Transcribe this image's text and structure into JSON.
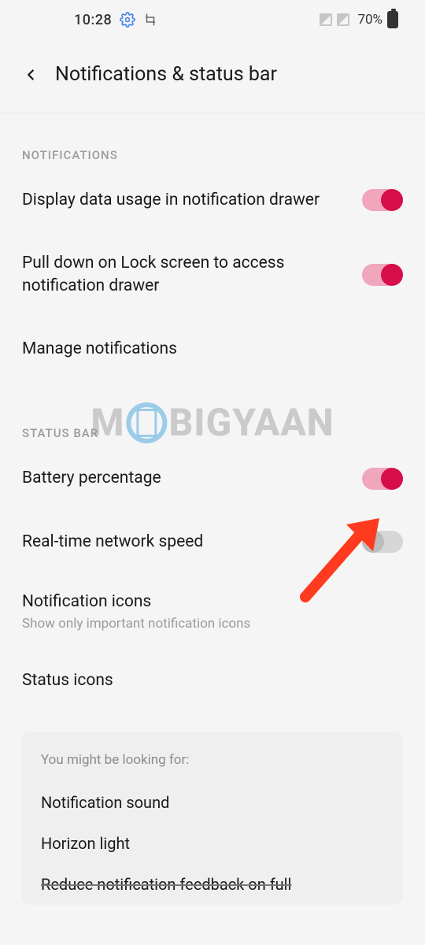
{
  "statusbar": {
    "time": "10:28",
    "battery_text": "70%"
  },
  "header": {
    "title": "Notifications & status bar"
  },
  "sections": {
    "notifications_label": "NOTIFICATIONS",
    "statusbar_label": "STATUS BAR"
  },
  "items": {
    "data_usage": {
      "title": "Display data usage in notification drawer",
      "toggle": true
    },
    "pull_down": {
      "title": "Pull down on Lock screen to access notification drawer",
      "toggle": true
    },
    "manage": {
      "title": "Manage notifications"
    },
    "battery_pct": {
      "title": "Battery percentage",
      "toggle": true
    },
    "net_speed": {
      "title": "Real-time network speed",
      "toggle": false
    },
    "notif_icons": {
      "title": "Notification icons",
      "sub": "Show only important notification icons"
    },
    "status_icons": {
      "title": "Status icons"
    }
  },
  "suggestions": {
    "label": "You might be looking for:",
    "item1": "Notification sound",
    "item2": "Horizon light",
    "item3_pre": "Reduce notific",
    "item3_strike": "ation feedback ",
    "item3_post": "on full"
  },
  "watermark": {
    "pre": "M",
    "post": "BIGYAAN"
  },
  "colors": {
    "accent_on_track": "#f0a6bd",
    "accent_on_knob": "#d60e4a",
    "off_track": "#d6d6d6",
    "off_knob": "#bcbcbc",
    "arrow": "#ff3a1f"
  }
}
